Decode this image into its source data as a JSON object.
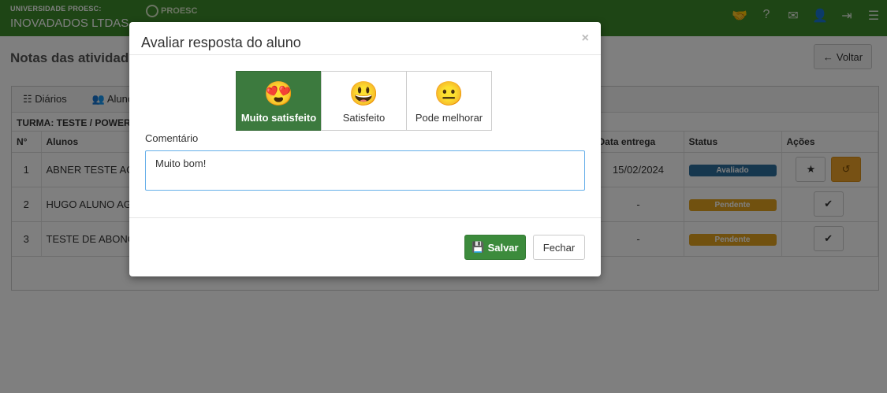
{
  "header": {
    "org_sup": "UNIVERSIDADE PROESC:",
    "org_main": "INOVADADOS LTDAS",
    "logo_text": "PROESC",
    "icons": [
      "handshake-icon",
      "help-icon",
      "mail-icon",
      "user-icon",
      "logout-icon",
      "menu-icon"
    ]
  },
  "page": {
    "title": "Notas das atividad",
    "back_button": "Voltar"
  },
  "panel": {
    "tabs": [
      "Diários",
      "Aluno"
    ],
    "turma": "TURMA: TESTE / POWER",
    "columns": [
      "N°",
      "Alunos",
      "Data entrega",
      "Status",
      "Ações"
    ],
    "rows": [
      {
        "n": "1",
        "aluno": "ABNER TESTE AC",
        "data": "15/02/2024",
        "status": "Avaliado"
      },
      {
        "n": "2",
        "aluno": "HUGO ALUNO AG",
        "data": "-",
        "status": "Pendente"
      },
      {
        "n": "3",
        "aluno": "TESTE DE ABONO",
        "data": "-",
        "status": "Pendente"
      }
    ]
  },
  "modal": {
    "title": "Avaliar resposta do aluno",
    "close": "×",
    "ratings": [
      {
        "label": "Muito satisfeito",
        "emoji": "😍",
        "selected": true
      },
      {
        "label": "Satisfeito",
        "emoji": "😃",
        "selected": false
      },
      {
        "label": "Pode melhorar",
        "emoji": "😐",
        "selected": false
      }
    ],
    "comment_label": "Comentário",
    "comment_value": "Muito bom!",
    "save_label": "Salvar",
    "close_label": "Fechar"
  },
  "colors": {
    "header_green": "#3c8b2a",
    "selected_rating": "#3c7a3e",
    "badge_done": "#2d6e9d",
    "badge_pending": "#e3a31e"
  }
}
